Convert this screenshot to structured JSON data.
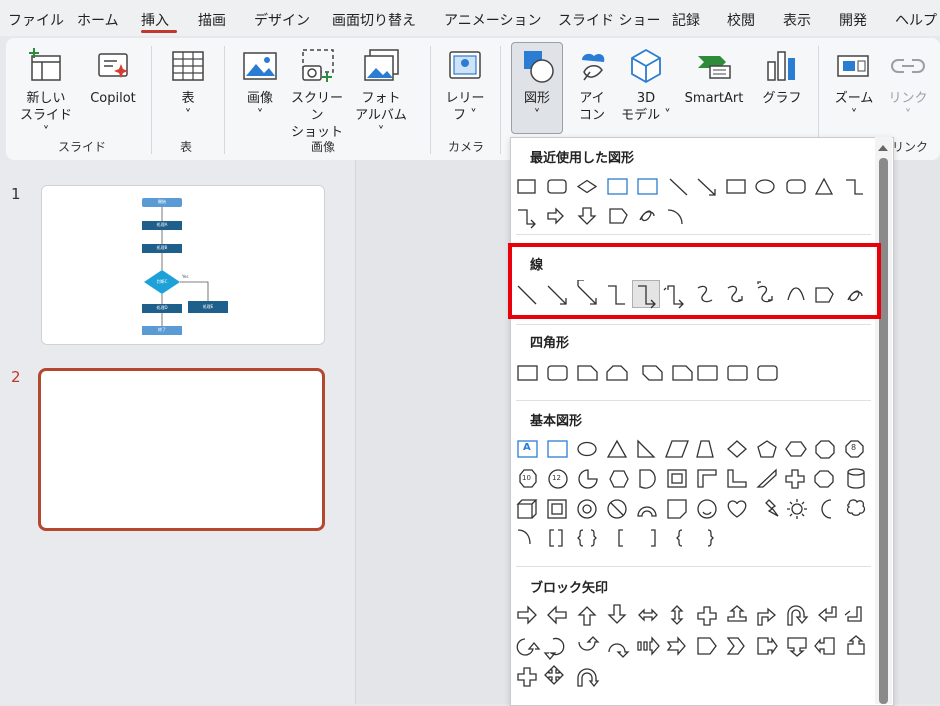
{
  "menu": {
    "tabs": [
      "ファイル",
      "ホーム",
      "挿入",
      "描画",
      "デザイン",
      "画面切り替え",
      "アニメーション",
      "スライド ショー",
      "記録",
      "校閲",
      "表示",
      "開発",
      "ヘルプ"
    ]
  },
  "ribbon": {
    "new_slide": "新しい\nスライド ˅",
    "copilot": "Copilot",
    "table": "表\n˅",
    "image": "画像\n˅",
    "screenshot": "スクリーン\nショット ˅",
    "photo_album": "フォト\nアルバム ˅",
    "cameo": "レリー\nフ ˅",
    "shapes": "図形\n˅",
    "icons": "アイ\nコン",
    "model3d": "3D\nモデル ˅",
    "smartart": "SmartArt",
    "chart": "グラフ",
    "zoom": "ズーム\n˅",
    "link": "リンク\n˅",
    "groups": {
      "slide": "スライド",
      "table": "表",
      "image": "画像",
      "camera": "カメラ",
      "link": "リンク"
    }
  },
  "slides": {
    "numbers": [
      "1",
      "2"
    ],
    "flow_labels": [
      "開始",
      "処理A",
      "処理B",
      "判断C",
      "処理D",
      "処理E",
      "終了",
      "Yes"
    ]
  },
  "gallery": {
    "sections": [
      "最近使用した図形",
      "線",
      "四角形",
      "基本図形",
      "ブロック矢印"
    ],
    "basic_labels": [
      "A",
      "10",
      "12",
      "8"
    ]
  },
  "colors": {
    "accent": "#c0392b",
    "highlight": "#e8000b",
    "selected_slide": "#b5472e"
  }
}
